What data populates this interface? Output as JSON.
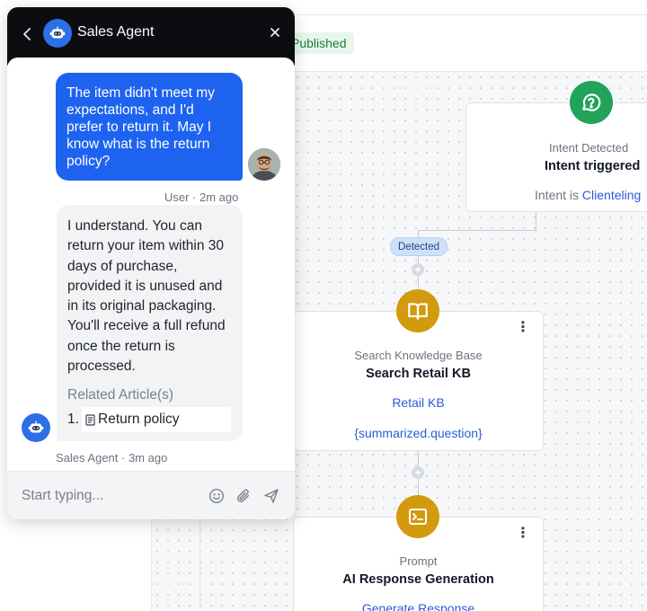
{
  "workflow": {
    "status": "Published"
  },
  "nodes": {
    "intent": {
      "kind": "Intent Detected",
      "title": "Intent triggered",
      "line_prefix": "Intent is",
      "line_value": "Clienteling"
    },
    "edge_label": "Detected",
    "knowledge_base": {
      "kind": "Search Knowledge Base",
      "title": "Search Retail KB",
      "source": "Retail KB",
      "query": "{summarized.question}"
    },
    "prompt": {
      "kind": "Prompt",
      "title": "AI Response Generation",
      "action": "Generate Response"
    }
  },
  "chat": {
    "title": "Sales Agent",
    "messages": {
      "user": {
        "text": "The item didn't meet my expectations, and I'd prefer to return it. May I know what is the return policy?",
        "meta": "User · 2m ago"
      },
      "agent": {
        "text": "I understand. You can return your item within 30 days of purchase, provided it is unused and in its original packaging. You'll receive a full refund once the return is processed.",
        "related_title": "Related Article(s)",
        "related_number": "1.",
        "related_article": "Return policy",
        "meta": "Sales Agent · 3m ago"
      }
    },
    "composer": {
      "placeholder": "Start typing..."
    }
  },
  "colors": {
    "accent": "#1e63f0",
    "intent_icon": "#21a35a",
    "step_icon": "#d39a0e",
    "link": "#2b5bd7"
  },
  "icons": [
    "back-icon",
    "bot-icon",
    "close-icon",
    "user-photo",
    "book-icon",
    "terminal-icon",
    "help-bubble-icon",
    "document-icon",
    "emoji-icon",
    "paperclip-icon",
    "send-icon",
    "kebab-icon",
    "plus-icon"
  ]
}
